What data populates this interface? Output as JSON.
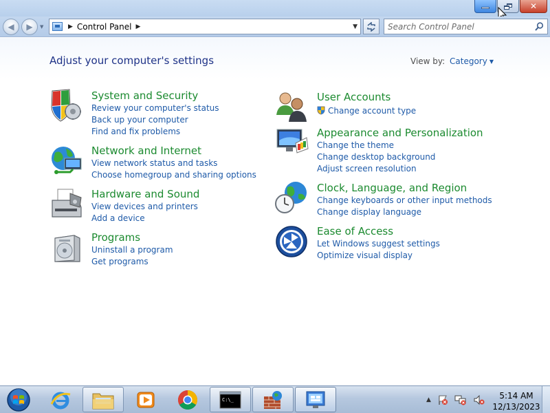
{
  "window": {
    "address": {
      "location": "Control Panel"
    },
    "search": {
      "placeholder": "Search Control Panel"
    }
  },
  "page": {
    "title": "Adjust your computer's settings",
    "view_by": {
      "label": "View by:",
      "value": "Category"
    }
  },
  "categories": [
    {
      "title": "System and Security",
      "icon": "shield-icon",
      "links": [
        "Review your computer's status",
        "Back up your computer",
        "Find and fix problems"
      ]
    },
    {
      "title": "Network and Internet",
      "icon": "network-globe-icon",
      "links": [
        "View network status and tasks",
        "Choose homegroup and sharing options"
      ]
    },
    {
      "title": "Hardware and Sound",
      "icon": "printer-icon",
      "links": [
        "View devices and printers",
        "Add a device"
      ]
    },
    {
      "title": "Programs",
      "icon": "programs-box-icon",
      "links": [
        "Uninstall a program",
        "Get programs"
      ]
    },
    {
      "title": "User Accounts",
      "icon": "users-icon",
      "links": [
        "Change account type"
      ]
    },
    {
      "title": "Appearance and Personalization",
      "icon": "monitor-palette-icon",
      "links": [
        "Change the theme",
        "Change desktop background",
        "Adjust screen resolution"
      ]
    },
    {
      "title": "Clock, Language, and Region",
      "icon": "clock-globe-icon",
      "links": [
        "Change keyboards or other input methods",
        "Change display language"
      ]
    },
    {
      "title": "Ease of Access",
      "icon": "ease-of-access-icon",
      "links": [
        "Let Windows suggest settings",
        "Optimize visual display"
      ]
    }
  ],
  "taskbar": {
    "items": [
      "start-orb-icon",
      "internet-explorer-icon",
      "file-explorer-icon",
      "media-player-icon",
      "chrome-icon",
      "command-prompt-icon",
      "firewall-icon",
      "control-panel-icon"
    ],
    "clock": {
      "time": "5:14 AM",
      "date": "12/13/2023"
    }
  },
  "colors": {
    "title_blue": "#1e3287",
    "category_green": "#1b8a2f",
    "link_blue": "#1e5aa8"
  }
}
